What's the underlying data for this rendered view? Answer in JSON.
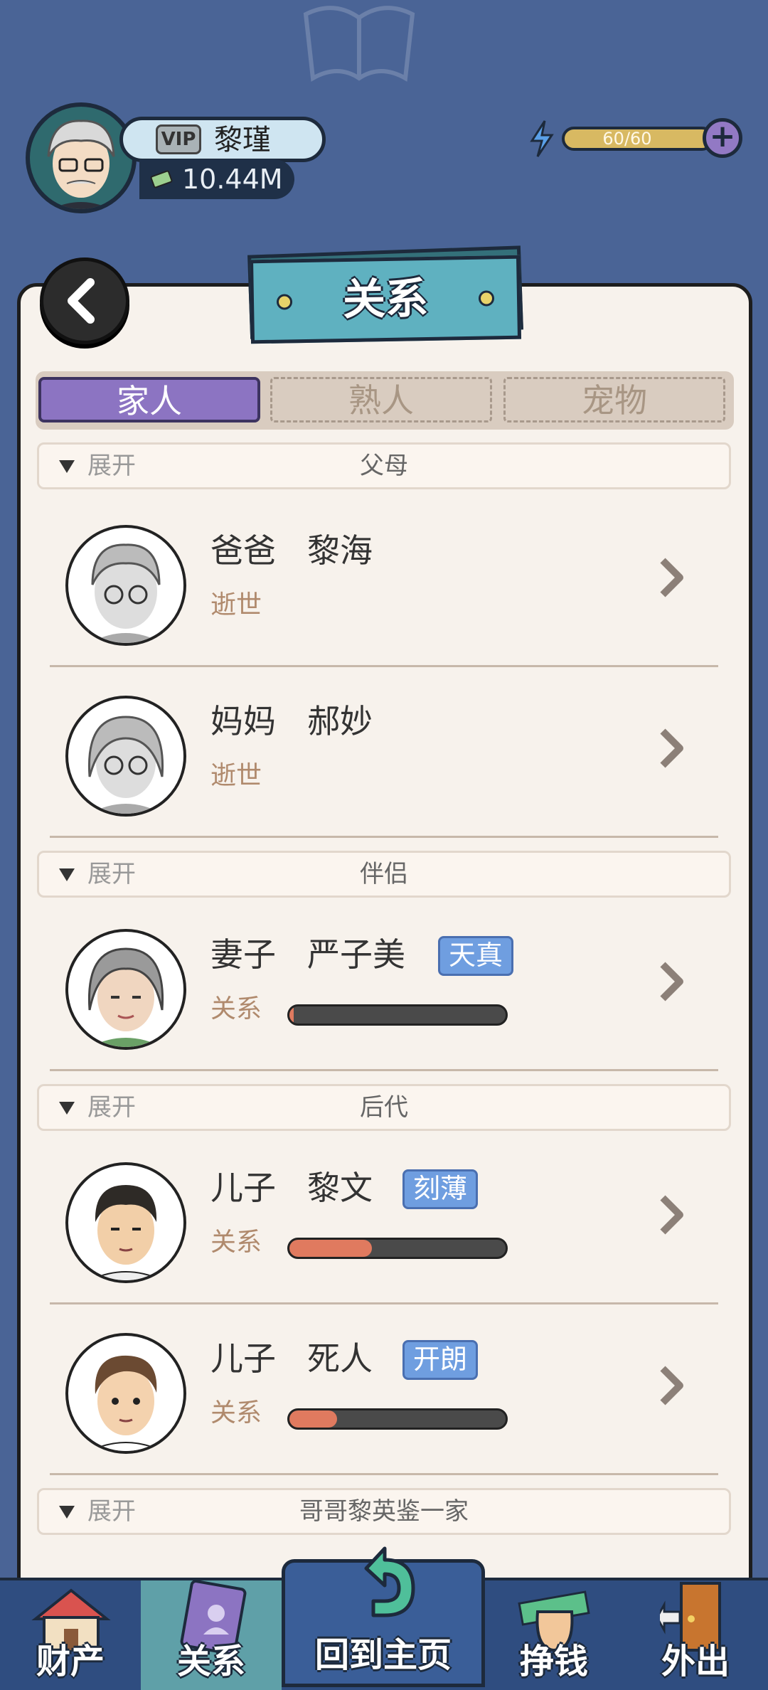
{
  "player": {
    "vip": "VIP",
    "name": "黎瑾",
    "money": "10.44M"
  },
  "energy": {
    "text": "60/60",
    "value": 60,
    "max": 60
  },
  "panel": {
    "title": "关系"
  },
  "tabs": [
    {
      "label": "家人",
      "active": true
    },
    {
      "label": "熟人",
      "active": false
    },
    {
      "label": "宠物",
      "active": false
    }
  ],
  "sections": {
    "parents": {
      "expand": "展开",
      "title": "父母"
    },
    "partner": {
      "expand": "展开",
      "title": "伴侣"
    },
    "children": {
      "expand": "展开",
      "title": "后代"
    },
    "brother": {
      "expand": "展开",
      "title": "哥哥黎英鉴一家"
    }
  },
  "members": [
    {
      "role": "爸爸",
      "name": "黎海",
      "status": "逝世"
    },
    {
      "role": "妈妈",
      "name": "郝妙",
      "status": "逝世"
    },
    {
      "role": "妻子",
      "name": "严子美",
      "trait": "天真",
      "status": "关系",
      "relationship": 0.02
    },
    {
      "role": "儿子",
      "name": "黎文",
      "trait": "刻薄",
      "status": "关系",
      "relationship": 0.38
    },
    {
      "role": "儿子",
      "name": "死人",
      "trait": "开朗",
      "status": "关系",
      "relationship": 0.22
    }
  ],
  "nav": {
    "property": "财产",
    "relations": "关系",
    "home": "回到主页",
    "earn": "挣钱",
    "outing": "外出"
  },
  "colors": {
    "accent_purple": "#8c74c2",
    "banner_teal": "#5fb1c0",
    "trait_blue": "#6f9ee0",
    "bar_fill": "#e07a5f"
  },
  "icons": [
    "back-arrow-icon",
    "lightning-icon",
    "plus-icon",
    "money-icon",
    "chevron-right-icon",
    "house-icon",
    "contact-book-icon",
    "undo-arrow-icon",
    "fist-money-icon",
    "door-icon"
  ]
}
